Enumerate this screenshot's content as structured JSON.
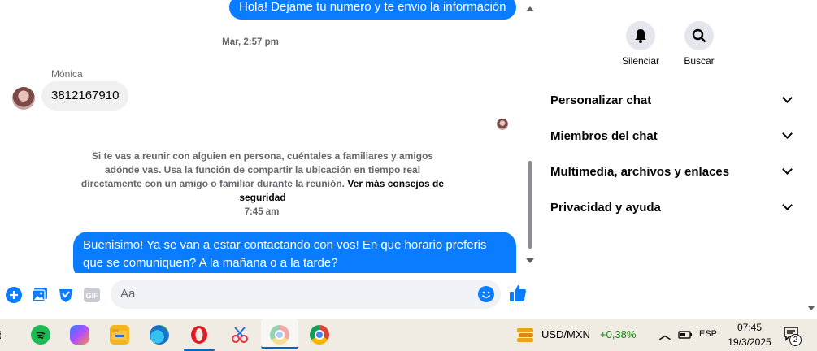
{
  "chat": {
    "messages": [
      {
        "kind": "out",
        "text": "Hola! Dejame tu numero y te envio la información"
      },
      {
        "kind": "timestamp",
        "text": "Mar, 2:57 pm"
      },
      {
        "kind": "sender",
        "text": "Mónica"
      },
      {
        "kind": "in",
        "text": "3812167910"
      },
      {
        "kind": "timestamp",
        "text": "7:45 am"
      },
      {
        "kind": "out",
        "text": "Buenisimo! Ya se van a estar contactando con vos! En que horario preferis que se comuniquen? A la mañana o a la tarde?"
      }
    ],
    "safety_notice": "Si te vas a reunir con alguien en persona, cuéntales a familiares y amigos adónde vas. Usa la función de compartir la ubicación en tiempo real directamente con un amigo o familiar durante la reunión.",
    "safety_link": "Ver más consejos de seguridad",
    "composer": {
      "placeholder": "Aa"
    }
  },
  "panel": {
    "actions": [
      {
        "label": "Silenciar",
        "icon": "bell-icon"
      },
      {
        "label": "Buscar",
        "icon": "search-icon"
      }
    ],
    "sections": [
      "Personalizar chat",
      "Miembros del chat",
      "Multimedia, archivos y enlaces",
      "Privacidad y ayuda"
    ]
  },
  "taskbar": {
    "currency": "USD/MXN",
    "change": "+0,38%",
    "language": "ESP",
    "time": "07:45",
    "date": "19/3/2025",
    "notifications": "2"
  },
  "colors": {
    "accent": "#0a7cff",
    "positive": "#0a8a0a",
    "taskbar": "#f0ebe3"
  }
}
